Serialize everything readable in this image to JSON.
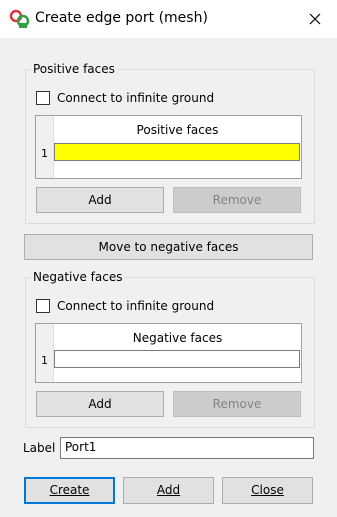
{
  "window": {
    "title": "Create edge port (mesh)",
    "app_icon": "app-logo-icon",
    "close_icon": "close-icon"
  },
  "positive": {
    "group_label": "Positive faces",
    "connect_label": "Connect to infinite ground",
    "connect_checked": false,
    "table_header": "Positive faces",
    "rows": [
      {
        "num": "1",
        "value": "",
        "highlight": "#ffff00"
      }
    ],
    "add_label": "Add",
    "remove_label": "Remove"
  },
  "move_label": "Move to negative faces",
  "negative": {
    "group_label": "Negative faces",
    "connect_label": "Connect to infinite ground",
    "connect_checked": false,
    "table_header": "Negative faces",
    "rows": [
      {
        "num": "1",
        "value": ""
      }
    ],
    "add_label": "Add",
    "remove_label": "Remove"
  },
  "label_field": {
    "label": "Label",
    "value": "Port1"
  },
  "footer": {
    "create_label": "Create",
    "add_label": "Add",
    "close_label": "Close"
  }
}
